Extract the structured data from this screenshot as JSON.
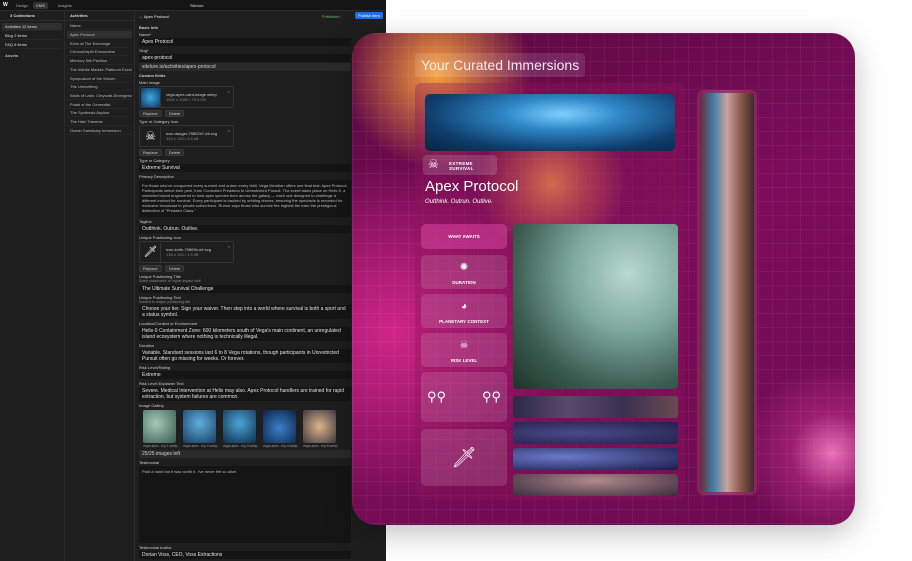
{
  "editor": {
    "topbar": {
      "tabs": [
        "Design",
        "CMS",
        "Insights"
      ],
      "site": "Sitelure"
    },
    "collections": {
      "title": "3 Collections",
      "items": [
        {
          "label": "Activities",
          "count": "12 items"
        },
        {
          "label": "Blog",
          "count": "2 items"
        },
        {
          "label": "FAQ",
          "count": "6 items"
        }
      ],
      "assets": "Assets"
    },
    "activities": {
      "title": "Activities",
      "column": "Name",
      "items": [
        "Apex Protocol",
        "Echo at The Exchange",
        "ChronoDepth Encounters",
        "Memory Silk Pavilion",
        "The Infinite Market: Platinum Exclusive",
        "Symposium of the Woven",
        "The Unearthing",
        "Walls of Latin: Chrysalis Emergence",
        "Feast of the Generalist",
        "The Synthesis Asylum",
        "The Halo Traverse",
        "Ocean Sanctuary Immersion"
      ]
    },
    "item": {
      "back_title": "Apex Protocol",
      "status": "Published",
      "publish": "Publish item",
      "basic_info": "Basic Info",
      "name_label": "Name*",
      "name_value": "Apex Protocol",
      "slug_label": "Slug*",
      "slug_value": "apex-protocol",
      "url": "sitelure.io/activities/apex-protocol",
      "custom_fields": "Custom fields",
      "main_image_label": "Main Image",
      "main_image_file": "vega-apex-card-image.webp",
      "main_image_size": "1500 x 1000 • 75.6 KB",
      "type_icon_label": "Type or Category Icon",
      "type_icon_file": "icon-danger-79802b7-##.svg",
      "type_icon_size": "133 x 133 • 2.4 kB",
      "replace": "Replace",
      "delete": "Delete",
      "type_label": "Type or Category",
      "type_value": "Extreme Survival",
      "desc_label": "Primary Description",
      "desc_value": "For those who've conquered every summit and outrun every thrill, Vega Meridian offers one final test: Apex Protocol. Participants select their peril, from Controlled Predation to Unrestricted Pursuit. The event takes place on Helix-9, a restricted island engineered to host apex species from across the galaxy — each one designed to challenge a different instinct for survival. Every participant is tracked by orbiting drones, ensuring the spectacle is recorded for exclusive broadcast to private subscribers. Rumor says those who survive the highest tier earn the prestigious distinction of \"Predator Class.\"",
      "tagline_label": "Tagline",
      "tagline_value": "Outthink. Outrun. Outlive.",
      "up_icon_label": "Unique Positioning Icon",
      "up_icon_file": "icon-knife-79809b-##.svg",
      "up_icon_size": "133 x 133 • 1.5 kB",
      "up_title_label": "Unique Positioning Title",
      "up_title_hint": "Some stats/metric or higher impact stuff",
      "up_title_value": "The Ultimate Survival Challenge",
      "up_text_label": "Unique Positioning Text",
      "up_text_hint": "Subtext to unique positioning title",
      "up_text_value": "Choose your tier. Sign your waiver. Then step into a world where survival is both a sport and a status symbol.",
      "loc_label": "Location/Context or Environment",
      "loc_value": "Helix-9 Containment Zone: 600 kilometers south of Vega's main continent, an unregulated island ecosystem where nothing is technically illegal.",
      "dur_label": "Duration",
      "dur_value": "Variable. Standard sessions last 6 to 8 Vega rotations, though participants in Unrestricted Pursuit often go missing for weeks. Or forever.",
      "risk_label": "Risk Level/Rating",
      "risk_value": "Extreme",
      "riskx_label": "Risk Level Explainer Text",
      "riskx_value": "Severe. Medical Intervention at Helix may also. Apex Protocol handlers are trained for rapid extraction, but system failures are common.",
      "gallery_label": "Image Gallery",
      "gallery": [
        "vega-apex...ery-1.webp",
        "vega-apex...ery-2.webp",
        "vega-apex...ery-3.webp",
        "vega-apex...ery-4.webp",
        "vega-apex...ery-5.webp"
      ],
      "gallery_count": "25/25 images left",
      "testimonial_label": "Testimonial",
      "testimonial_value": "Paid a hand but it was worth it. I've never felt so alive.",
      "author_label": "Testimonial Author",
      "author_value": "Dorian Voss, CEO, Voss Extractions"
    }
  },
  "card": {
    "title": "Your Curated Immersions",
    "category": "EXTREME SURVIVAL",
    "name": "Apex Protocol",
    "tagline": "Outthink. Outrun. Outlive.",
    "tiles": [
      "WHAT AWAITS",
      "DURATION",
      "PLANETARY CONTEXT",
      "RISK LEVEL"
    ],
    "accent": "#7d0d5c"
  }
}
